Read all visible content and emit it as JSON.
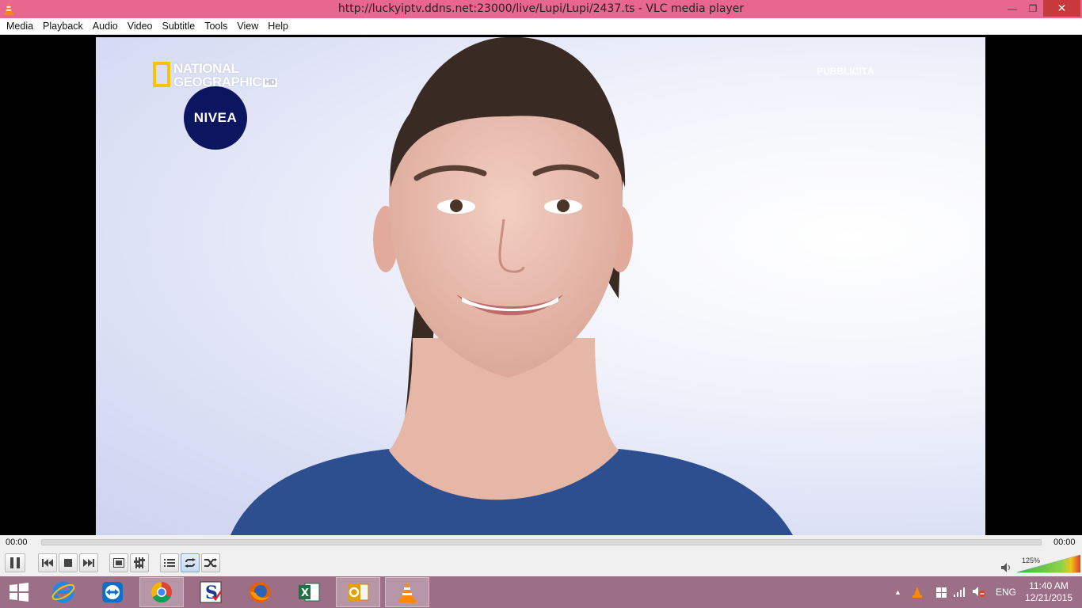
{
  "window": {
    "title": "http://luckyiptv.ddns.net:23000/live/Lupi/Lupi/2437.ts - VLC media player",
    "minimize_glyph": "—",
    "maximize_glyph": "❐",
    "close_glyph": "✕"
  },
  "menu": {
    "items": [
      "Media",
      "Playback",
      "Audio",
      "Video",
      "Subtitle",
      "Tools",
      "View",
      "Help"
    ]
  },
  "video": {
    "channel_logo_line1": "NATIONAL",
    "channel_logo_line2": "GEOGRAPHIC",
    "channel_logo_hd": "HD",
    "brand_badge": "NIVEA",
    "overlay_text": "PUBBLICITÀ"
  },
  "playback": {
    "elapsed": "00:00",
    "total": "00:00",
    "progress_fraction": 0
  },
  "controls": {
    "pause": "pause-icon",
    "previous": "previous-icon",
    "stop": "stop-icon",
    "next": "next-icon",
    "fullscreen": "fullscreen-icon",
    "extended": "extended-settings-icon",
    "playlist": "playlist-icon",
    "loop": "loop-icon",
    "shuffle": "shuffle-icon",
    "loop_active": true
  },
  "volume": {
    "percent_label": "125%",
    "level_fraction": 1.0
  },
  "taskbar": {
    "apps": [
      "start",
      "internet-explorer",
      "teamviewer",
      "chrome",
      "sharex",
      "firefox",
      "excel",
      "outlook",
      "vlc"
    ],
    "active_apps": [
      "chrome",
      "outlook",
      "vlc"
    ],
    "language": "ENG",
    "time": "11:40 AM",
    "date": "12/21/2015"
  },
  "colors": {
    "titlebar": "#e9678f",
    "close_button": "#c7393a",
    "taskbar": "#9c6f86",
    "nivea_blue": "#0b1560",
    "natgeo_yellow": "#f5c400"
  }
}
